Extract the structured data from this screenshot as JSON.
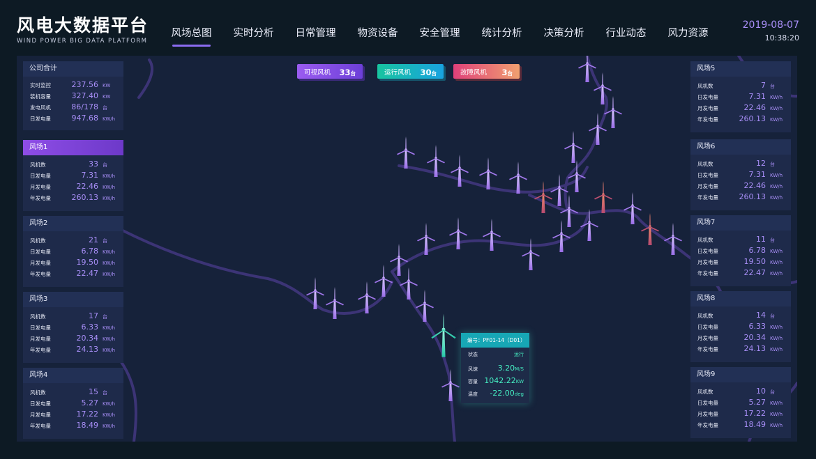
{
  "header": {
    "title": "风电大数据平台",
    "subtitle": "WIND POWER BIG DATA PLATFORM",
    "date": "2019-08-07",
    "time": "10:38:20"
  },
  "nav": [
    {
      "label": "风场总图",
      "active": true
    },
    {
      "label": "实时分析"
    },
    {
      "label": "日常管理"
    },
    {
      "label": "物资设备"
    },
    {
      "label": "安全管理"
    },
    {
      "label": "统计分析"
    },
    {
      "label": "决策分析"
    },
    {
      "label": "行业动态"
    },
    {
      "label": "风力资源"
    }
  ],
  "badges": {
    "visible": {
      "label": "可视风机",
      "count": "33",
      "unit": "台"
    },
    "running": {
      "label": "运行风机",
      "count": "30",
      "unit": "台"
    },
    "fault": {
      "label": "故障风机",
      "count": "3",
      "unit": "台"
    }
  },
  "company": {
    "title": "公司合计",
    "rows": [
      {
        "label": "实时监控",
        "value": "237.56",
        "unit": "KW"
      },
      {
        "label": "装机容量",
        "value": "327.40",
        "unit": "KW"
      },
      {
        "label": "发电风机",
        "value": "86/178",
        "unit": "台"
      },
      {
        "label": "日发电量",
        "value": "947.68",
        "unit": "KW/h"
      }
    ]
  },
  "row_labels": {
    "count": "风机数",
    "daily": "日发电量",
    "monthly": "月发电量",
    "yearly": "年发电量"
  },
  "units": {
    "count": "台",
    "energy": "KW/h"
  },
  "farms_left": [
    {
      "name": "风场1",
      "count": "33",
      "daily": "7.31",
      "monthly": "22.46",
      "yearly": "260.13",
      "highlight": true
    },
    {
      "name": "风场2",
      "count": "21",
      "daily": "6.78",
      "monthly": "19.50",
      "yearly": "22.47"
    },
    {
      "name": "风场3",
      "count": "17",
      "daily": "6.33",
      "monthly": "20.34",
      "yearly": "24.13"
    },
    {
      "name": "风场4",
      "count": "15",
      "daily": "5.27",
      "monthly": "17.22",
      "yearly": "18.49"
    }
  ],
  "farms_right": [
    {
      "name": "风场5",
      "count": "7",
      "daily": "7.31",
      "monthly": "22.46",
      "yearly": "260.13"
    },
    {
      "name": "风场6",
      "count": "12",
      "daily": "7.31",
      "monthly": "22.46",
      "yearly": "260.13"
    },
    {
      "name": "风场7",
      "count": "11",
      "daily": "6.78",
      "monthly": "19.50",
      "yearly": "22.47"
    },
    {
      "name": "风场8",
      "count": "14",
      "daily": "6.33",
      "monthly": "20.34",
      "yearly": "24.13"
    },
    {
      "name": "风场9",
      "count": "10",
      "daily": "5.27",
      "monthly": "17.22",
      "yearly": "18.49"
    }
  ],
  "tooltip": {
    "id": "编号：PF01-14（D01）",
    "status_label": "状态",
    "status_value": "运行",
    "speed_label": "风速",
    "speed_value": "3.20",
    "speed_unit": "M/S",
    "capacity_label": "容量",
    "capacity_value": "1042.22",
    "capacity_unit": "KW",
    "temp_label": "温度",
    "temp_value": "-22.00",
    "temp_unit": "deg"
  },
  "colors": {
    "turbine_normal": "#b58cf5",
    "turbine_fault": "#e8674f",
    "turbine_selected": "#3ee8c2",
    "road": "#3c3476"
  }
}
